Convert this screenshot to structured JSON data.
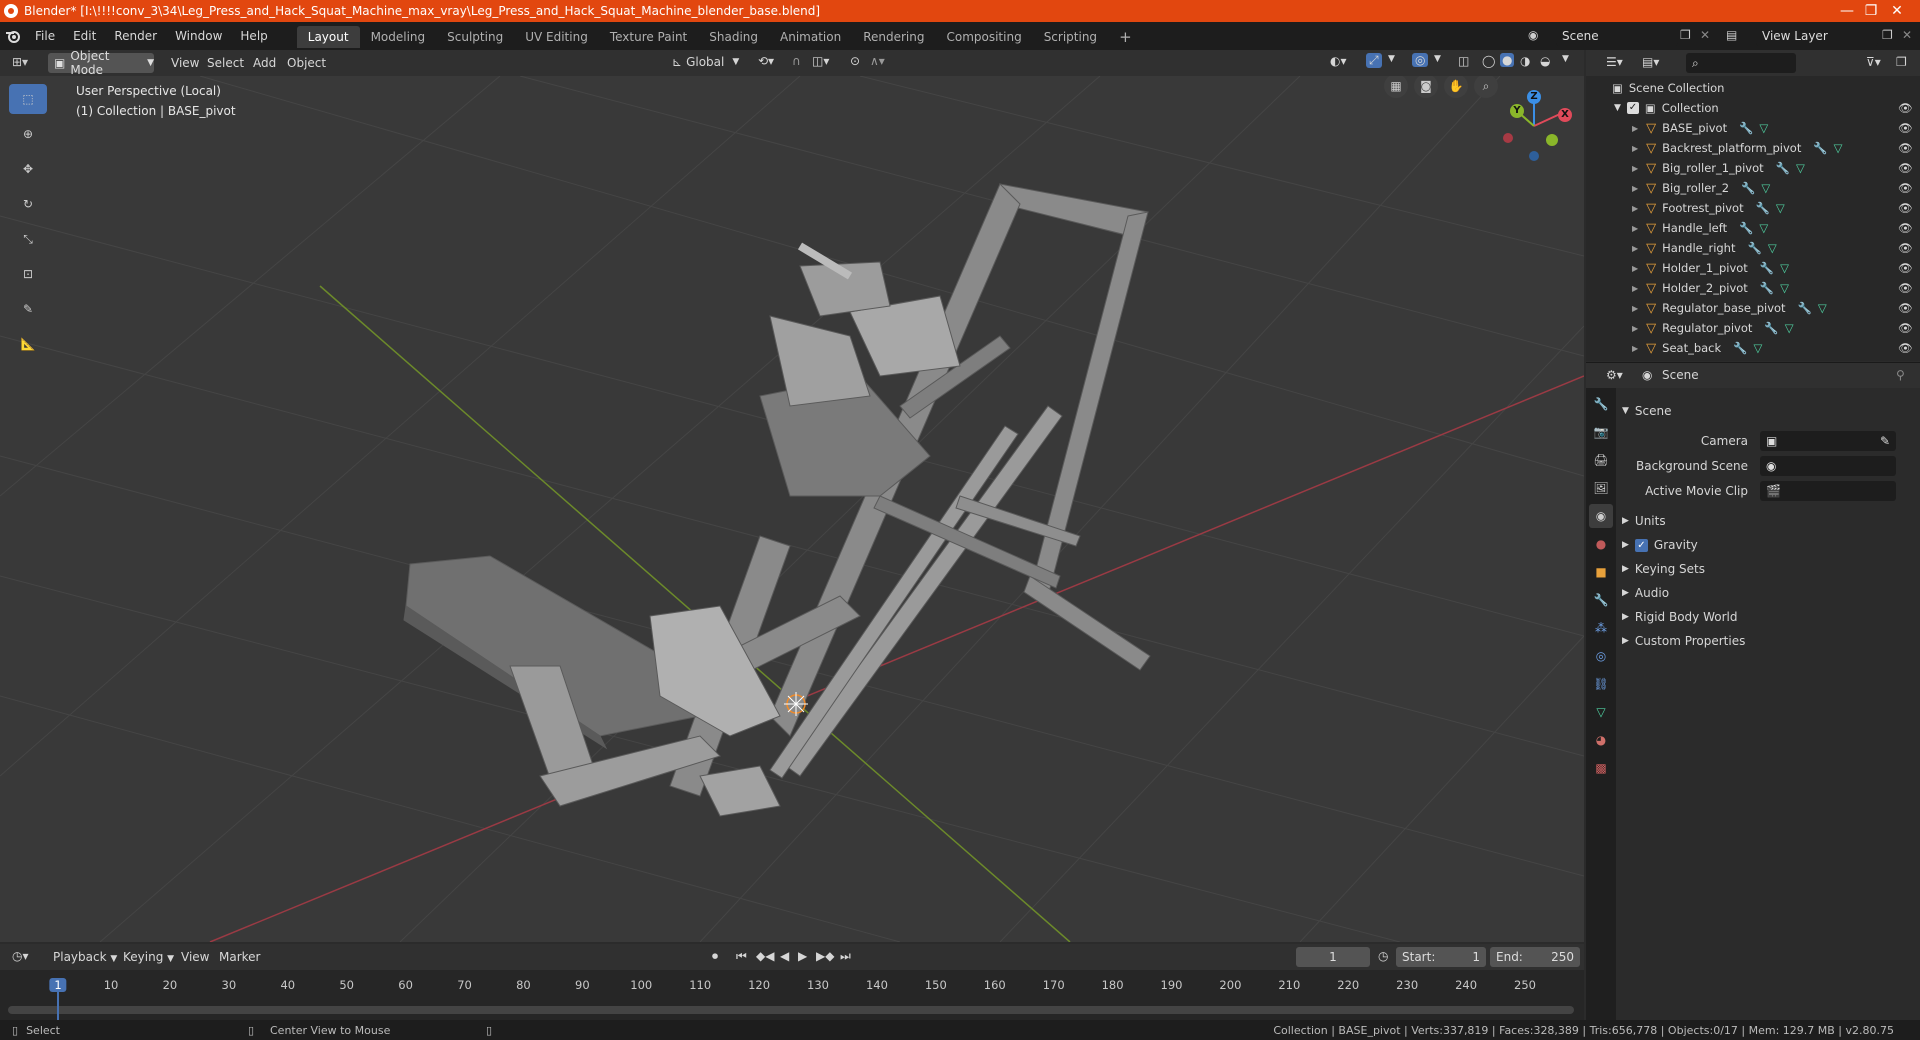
{
  "window": {
    "title": "Blender* [I:\\!!!!conv_3\\34\\Leg_Press_and_Hack_Squat_Machine_max_vray\\Leg_Press_and_Hack_Squat_Machine_blender_base.blend]",
    "minimize": "—",
    "maximize": "❐",
    "close": "✕"
  },
  "menus": [
    "File",
    "Edit",
    "Render",
    "Window",
    "Help"
  ],
  "workspaces": [
    "Layout",
    "Modeling",
    "Sculpting",
    "UV Editing",
    "Texture Paint",
    "Shading",
    "Animation",
    "Rendering",
    "Compositing",
    "Scripting"
  ],
  "workspace_add": "+",
  "scene_selector": "Scene",
  "view_layer": "View Layer",
  "viewport": {
    "mode": "Object Mode",
    "menus": [
      "View",
      "Select",
      "Add",
      "Object"
    ],
    "orientation": "Global",
    "overlay_line1": "User Perspective (Local)",
    "overlay_line2": "(1) Collection | BASE_pivot",
    "gizmo": {
      "z": "Z",
      "y": "Y",
      "x": "X"
    }
  },
  "outliner": {
    "root": "Scene Collection",
    "collection": "Collection",
    "items": [
      "BASE_pivot",
      "Backrest_platform_pivot",
      "Big_roller_1_pivot",
      "Big_roller_2",
      "Footrest_pivot",
      "Handle_left",
      "Handle_right",
      "Holder_1_pivot",
      "Holder_2_pivot",
      "Regulator_base_pivot",
      "Regulator_pivot",
      "Seat_back"
    ]
  },
  "properties": {
    "header": "Scene",
    "section": "Scene",
    "camera_label": "Camera",
    "background_scene_label": "Background Scene",
    "active_movie_clip_label": "Active Movie Clip",
    "panels": [
      "Units",
      "Gravity",
      "Keying Sets",
      "Audio",
      "Rigid Body World",
      "Custom Properties"
    ]
  },
  "timeline": {
    "menus": [
      "Playback",
      "Keying",
      "View",
      "Marker"
    ],
    "current_frame": "1",
    "start_label": "Start:",
    "start": "1",
    "end_label": "End:",
    "end": "250",
    "ticks": [
      "1",
      "10",
      "20",
      "30",
      "40",
      "50",
      "60",
      "70",
      "80",
      "90",
      "100",
      "110",
      "120",
      "130",
      "140",
      "150",
      "160",
      "170",
      "180",
      "190",
      "200",
      "210",
      "220",
      "230",
      "240",
      "250"
    ]
  },
  "status": {
    "left": "Select",
    "middle": "Center View to Mouse",
    "right": "Collection | BASE_pivot | Verts:337,819 | Faces:328,389 | Tris:656,778 | Objects:0/17 | Mem: 129.7 MB | v2.80.75"
  },
  "colors": {
    "accent": "#4772b3",
    "titlebar": "#e2470f",
    "x_axis": "#e04a5a",
    "y_axis": "#8ab62a",
    "z_axis": "#3b8fe6",
    "object_orange": "#e8a13b",
    "modifier_blue": "#6ea0e6",
    "mesh_green": "#4fcfa0"
  }
}
